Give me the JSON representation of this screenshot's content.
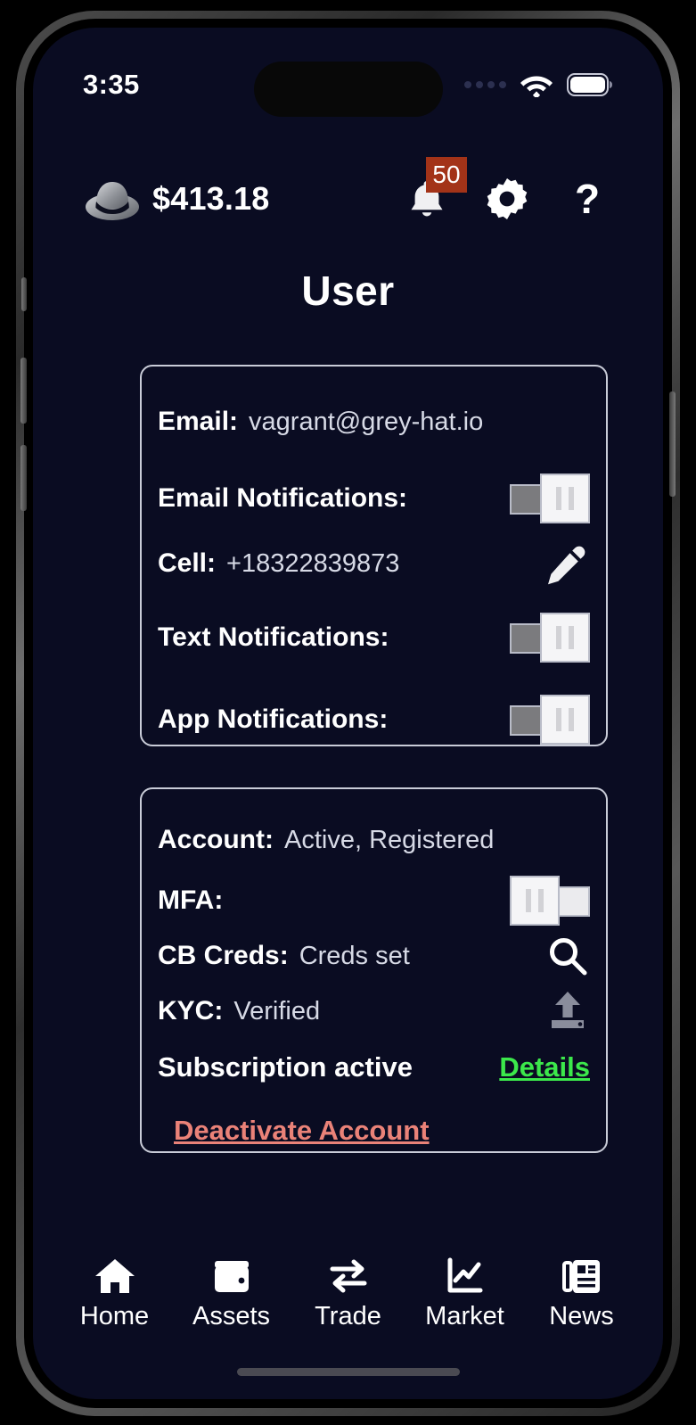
{
  "status_bar": {
    "time": "3:35",
    "cellular_icon": "cellular-dots-icon",
    "wifi_icon": "wifi-icon",
    "battery_icon": "battery-full-icon"
  },
  "header": {
    "logo_icon": "grey-hat-logo",
    "balance": "$413.18",
    "notifications": {
      "icon": "bell-icon",
      "badge_count": "50",
      "badge_color": "#a33318"
    },
    "settings_icon": "gear-icon",
    "help_icon": "?",
    "help_icon_name": "question-mark-icon"
  },
  "page": {
    "title": "User"
  },
  "profile_card": {
    "email": {
      "label": "Email:",
      "value": "vagrant@grey-hat.io"
    },
    "email_notifications": {
      "label": "Email Notifications:",
      "state": "on"
    },
    "cell": {
      "label": "Cell:",
      "value": "+18322839873",
      "edit_icon": "pencil-icon"
    },
    "text_notifications": {
      "label": "Text Notifications:",
      "state": "on"
    },
    "app_notifications": {
      "label": "App Notifications:",
      "state": "on"
    }
  },
  "account_card": {
    "account": {
      "label": "Account:",
      "value": "Active, Registered"
    },
    "mfa": {
      "label": "MFA:",
      "state": "off"
    },
    "cb_creds": {
      "label": "CB Creds:",
      "value": "Creds set",
      "action_icon": "search-icon"
    },
    "kyc": {
      "label": "KYC:",
      "value": "Verified",
      "action_icon": "upload-icon"
    },
    "subscription": {
      "label": "Subscription active",
      "details_link": "Details",
      "details_color": "#3ce84b"
    },
    "deactivate_link": "Deactivate Account",
    "deactivate_color": "#ea8278"
  },
  "bottom_nav": {
    "items": [
      {
        "label": "Home",
        "icon": "home-icon"
      },
      {
        "label": "Assets",
        "icon": "wallet-icon"
      },
      {
        "label": "Trade",
        "icon": "swap-arrows-icon"
      },
      {
        "label": "Market",
        "icon": "line-chart-icon"
      },
      {
        "label": "News",
        "icon": "newspaper-icon"
      }
    ]
  },
  "theme": {
    "background": "#0a0c22",
    "card_border": "#c9ccd8",
    "text": "#ffffff"
  }
}
